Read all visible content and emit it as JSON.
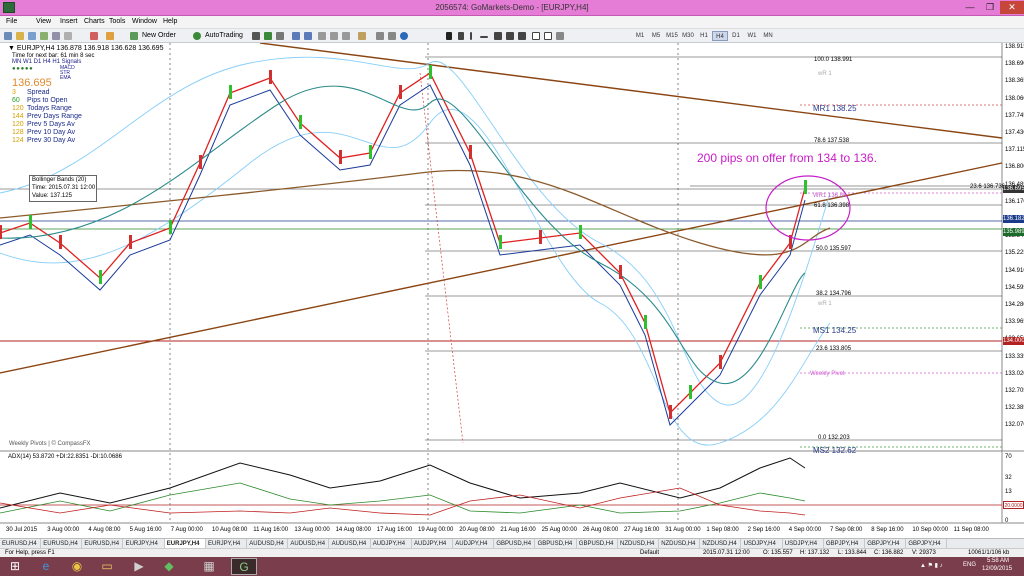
{
  "window": {
    "title": "2056574: GoMarkets-Demo - [EURJPY,H4]",
    "min": "—",
    "max": "❐",
    "close": "✕"
  },
  "menu": [
    "File",
    "View",
    "Insert",
    "Charts",
    "Tools",
    "Window",
    "Help"
  ],
  "toolbar": {
    "new_order": "New Order",
    "autotrading": "AutoTrading",
    "timeframes": [
      "M1",
      "M5",
      "M15",
      "M30",
      "H1",
      "H4",
      "D1",
      "W1",
      "MN"
    ]
  },
  "chart": {
    "header": "▼ EURJPY,H4  136.878 136.918 136.628 136.695",
    "timer_line": "Time for next bar: 61 min 8 sec",
    "tf_row": "MN W1 D1 H4 H1 Signals",
    "ind_labels": [
      "MACD",
      "STR",
      "EMA"
    ],
    "bid": "136.695",
    "stats": [
      {
        "value": "3",
        "label": "Spread"
      },
      {
        "value": "60",
        "label": "Pips to Open"
      },
      {
        "value": "120",
        "label": "Todays Range"
      },
      {
        "value": "144",
        "label": "Prev Days Range"
      },
      {
        "value": "120",
        "label": "Prev 5 Days Av"
      },
      {
        "value": "128",
        "label": "Prev 10 Day Av"
      },
      {
        "value": "124",
        "label": "Prev 30 Day Av"
      }
    ],
    "bb_tooltip": [
      "Bollinger Bands (20)",
      "Time: 2015.07.31 12:00",
      "Value: 137.125"
    ],
    "annotation": "200 pips on offer from 134 to 136.",
    "watermark": "Weekly Pivots | © CompassFX",
    "fib_labels": [
      "100.0 138.991",
      "78.6 137.538",
      "61.8 136.398",
      "50.0 135.597",
      "38.2 134.796",
      "23.6 133.805",
      "0.0 132.203",
      "23.6 136.736"
    ],
    "pivot_labels": [
      "MR1  138.25",
      "MS1  134.25",
      "MS2  132.62",
      "WR1 136.85",
      "wR 1",
      "Weekly Pivot"
    ],
    "price_axis": [
      "138.915",
      "138.690",
      "138.365",
      "138.060",
      "137.745",
      "137.430",
      "137.115",
      "136.800",
      "136.485",
      "136.170",
      "135.855",
      "135.540",
      "135.225",
      "134.910",
      "134.595",
      "134.280",
      "133.965",
      "133.650",
      "133.335",
      "133.020",
      "132.705",
      "132.385",
      "132.070"
    ],
    "price_boxes": [
      {
        "v": "136.695",
        "bg": "#333333"
      },
      {
        "v": "136.182",
        "bg": "#1a3a8a"
      },
      {
        "v": "135.989",
        "bg": "#1a6a2a"
      },
      {
        "v": "134.000",
        "bg": "#b22222"
      }
    ],
    "adx_label": "ADX(14) 53.8720 +DI:22.8351 -DI:10.0686",
    "adx_axis": [
      "70",
      "32",
      "13",
      "20.0000",
      "0"
    ],
    "time_axis": [
      "30 Jul 2015",
      "3 Aug 00:00",
      "4 Aug 08:00",
      "5 Aug 16:00",
      "7 Aug 00:00",
      "10 Aug 08:00",
      "11 Aug 16:00",
      "13 Aug 00:00",
      "14 Aug 08:00",
      "17 Aug 16:00",
      "19 Aug 00:00",
      "20 Aug 08:00",
      "21 Aug 16:00",
      "25 Aug 00:00",
      "26 Aug 08:00",
      "27 Aug 16:00",
      "31 Aug 00:00",
      "1 Sep 08:00",
      "2 Sep 16:00",
      "4 Sep 00:00",
      "7 Sep 08:00",
      "8 Sep 16:00",
      "10 Sep 00:00",
      "11 Sep 08:00"
    ]
  },
  "tabs": [
    "EURUSD,H4",
    "EURUSD,H4",
    "EURUSD,H4",
    "EURJPY,H4",
    "EURJPY,H4",
    "EURJPY,H4",
    "AUDUSD,H4",
    "AUDUSD,H4",
    "AUDUSD,H4",
    "AUDJPY,H4",
    "AUDJPY,H4",
    "AUDJPY,H4",
    "GBPUSD,H4",
    "GBPUSD,H4",
    "GBPUSD,H4",
    "NZDUSD,H4",
    "NZDUSD,H4",
    "NZDUSD,H4",
    "USDJPY,H4",
    "USDJPY,H4",
    "GBPJPY,H4",
    "GBPJPY,H4",
    "GBPJPY,H4"
  ],
  "active_tab": 4,
  "status": {
    "help": "For Help, press F1",
    "profile": "Default",
    "time": "2015.07.31 12:00",
    "o": "O: 135.557",
    "h": "H: 137.132",
    "l": "L: 133.844",
    "c": "C: 136.882",
    "v": "V: 29373",
    "mem": "10061/1/106 kb"
  },
  "taskbar": {
    "lang": "ENG",
    "time": "5:58 AM",
    "date": "12/09/2015"
  }
}
